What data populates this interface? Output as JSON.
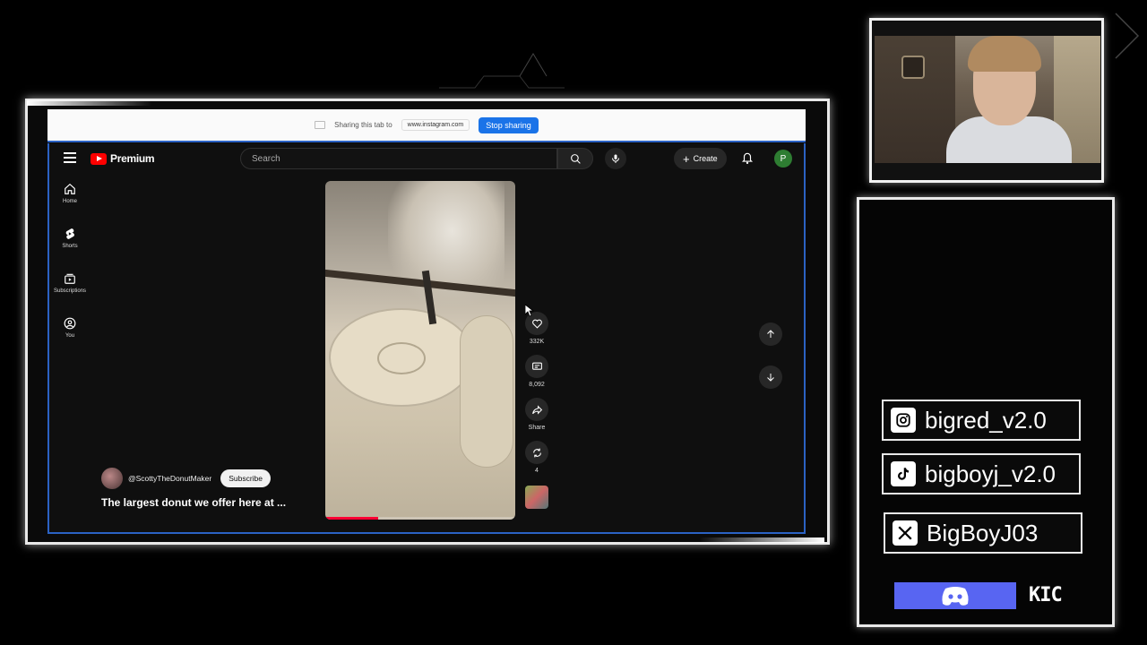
{
  "browser": {
    "share_text": "Sharing this tab to",
    "share_url": "www.instagram.com",
    "stop_sharing": "Stop sharing"
  },
  "youtube": {
    "logo_text": "Premium",
    "search_placeholder": "Search",
    "create_label": "Create",
    "avatar_letter": "P",
    "nav": [
      {
        "label": "Home",
        "icon": "home-icon"
      },
      {
        "label": "Shorts",
        "icon": "shorts-icon"
      },
      {
        "label": "Subscriptions",
        "icon": "subscriptions-icon"
      },
      {
        "label": "You",
        "icon": "user-icon"
      }
    ],
    "short": {
      "channel": "@ScottyTheDonutMaker",
      "subscribe": "Subscribe",
      "caption": "The largest donut we offer here at ...",
      "likes": "332K",
      "comments": "8,092",
      "share": "Share",
      "remix": "4",
      "progress": 0.28
    }
  },
  "overlay": {
    "instagram": "bigred_v2.0",
    "tiktok": "bigboyj_v2.0",
    "x": "BigBoyJ03",
    "kick": "KIC"
  },
  "colors": {
    "youtube_red": "#ff0000",
    "share_blue": "#1a73e8",
    "discord": "#5865f2",
    "avatar_green": "#2e7d32"
  }
}
